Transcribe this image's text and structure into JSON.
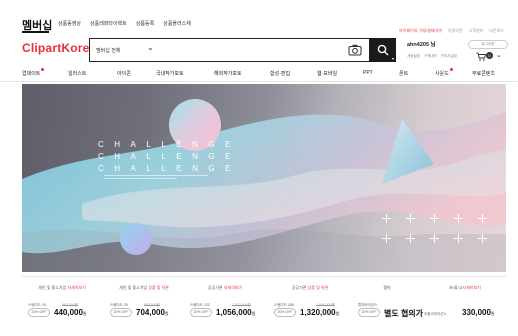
{
  "top": {
    "brand_tab": "멤버십",
    "nav": [
      "상품동영상",
      "상품레퍼타이택트",
      "상품등록",
      "상품플러스채"
    ],
    "right_links": [
      "마이페이지 구매/결제내역",
      "이용약관",
      "고객센터",
      "다운로드"
    ]
  },
  "header": {
    "logo": "ClipartKorea",
    "search_scope": "멤버십 전체",
    "search_placeholder": "",
    "username": "ahn4205 님",
    "user_links": [
      "계정설정",
      "구매내역",
      "관리자설정"
    ],
    "logout_label": "로그아웃",
    "cart_count": "0"
  },
  "categories": [
    {
      "label": "업데이트",
      "dot": true
    },
    {
      "label": "일러스트",
      "dot": false
    },
    {
      "label": "아이콘",
      "dot": false
    },
    {
      "label": "국내작가포토",
      "dot": false
    },
    {
      "label": "해외작가포토",
      "dot": false
    },
    {
      "label": "합성·편집",
      "dot": false
    },
    {
      "label": "웹·모바일",
      "dot": false
    },
    {
      "label": "PPT",
      "dot": false
    },
    {
      "label": "폰트",
      "dot": false
    },
    {
      "label": "사운드",
      "dot": true
    },
    {
      "label": "무료콘텐츠",
      "dot": false
    }
  ],
  "hero": {
    "line1": "CHALLENGE",
    "line2": "CHALLENGE",
    "line3": "CHALLENGE"
  },
  "pricing": [
    {
      "head": "개인 및 중소기업",
      "head_accent": "자세히보기",
      "plan": "스탠다드 15",
      "orig": "550,000원",
      "off": "20% OFF",
      "price": "440,000",
      "unit": "원"
    },
    {
      "head": "개인 및 중소기업",
      "head_accent": "상품 및 약관",
      "plan": "스탠다드 20",
      "orig": "880,000원",
      "off": "20% OFF",
      "price": "704,000",
      "unit": "원"
    },
    {
      "head": "공공기관",
      "head_accent": "자세히보기",
      "plan": "스탠다드 132",
      "orig": "1,320,000원",
      "off": "20% OFF",
      "price": "1,056,000",
      "unit": "원"
    },
    {
      "head": "공공기관",
      "head_accent": "상품 및 약관",
      "plan": "스탠다드 165",
      "orig": "1,650,000원",
      "off": "20% OFF",
      "price": "1,320,000",
      "unit": "원"
    },
    {
      "head": "협약",
      "head_accent": "",
      "plan": "특약라이선스",
      "orig": "",
      "off": "20% OFF",
      "price": "별도 협의가",
      "unit": ""
    },
    {
      "head": "초/중/고",
      "head_accent": "자세히보기",
      "plan": "초중고라이선스",
      "orig": "",
      "off": "",
      "price": "330,000",
      "unit": "원"
    }
  ],
  "colors": {
    "brand_red": "#e8313d",
    "search_button": "#1a1a1a"
  }
}
